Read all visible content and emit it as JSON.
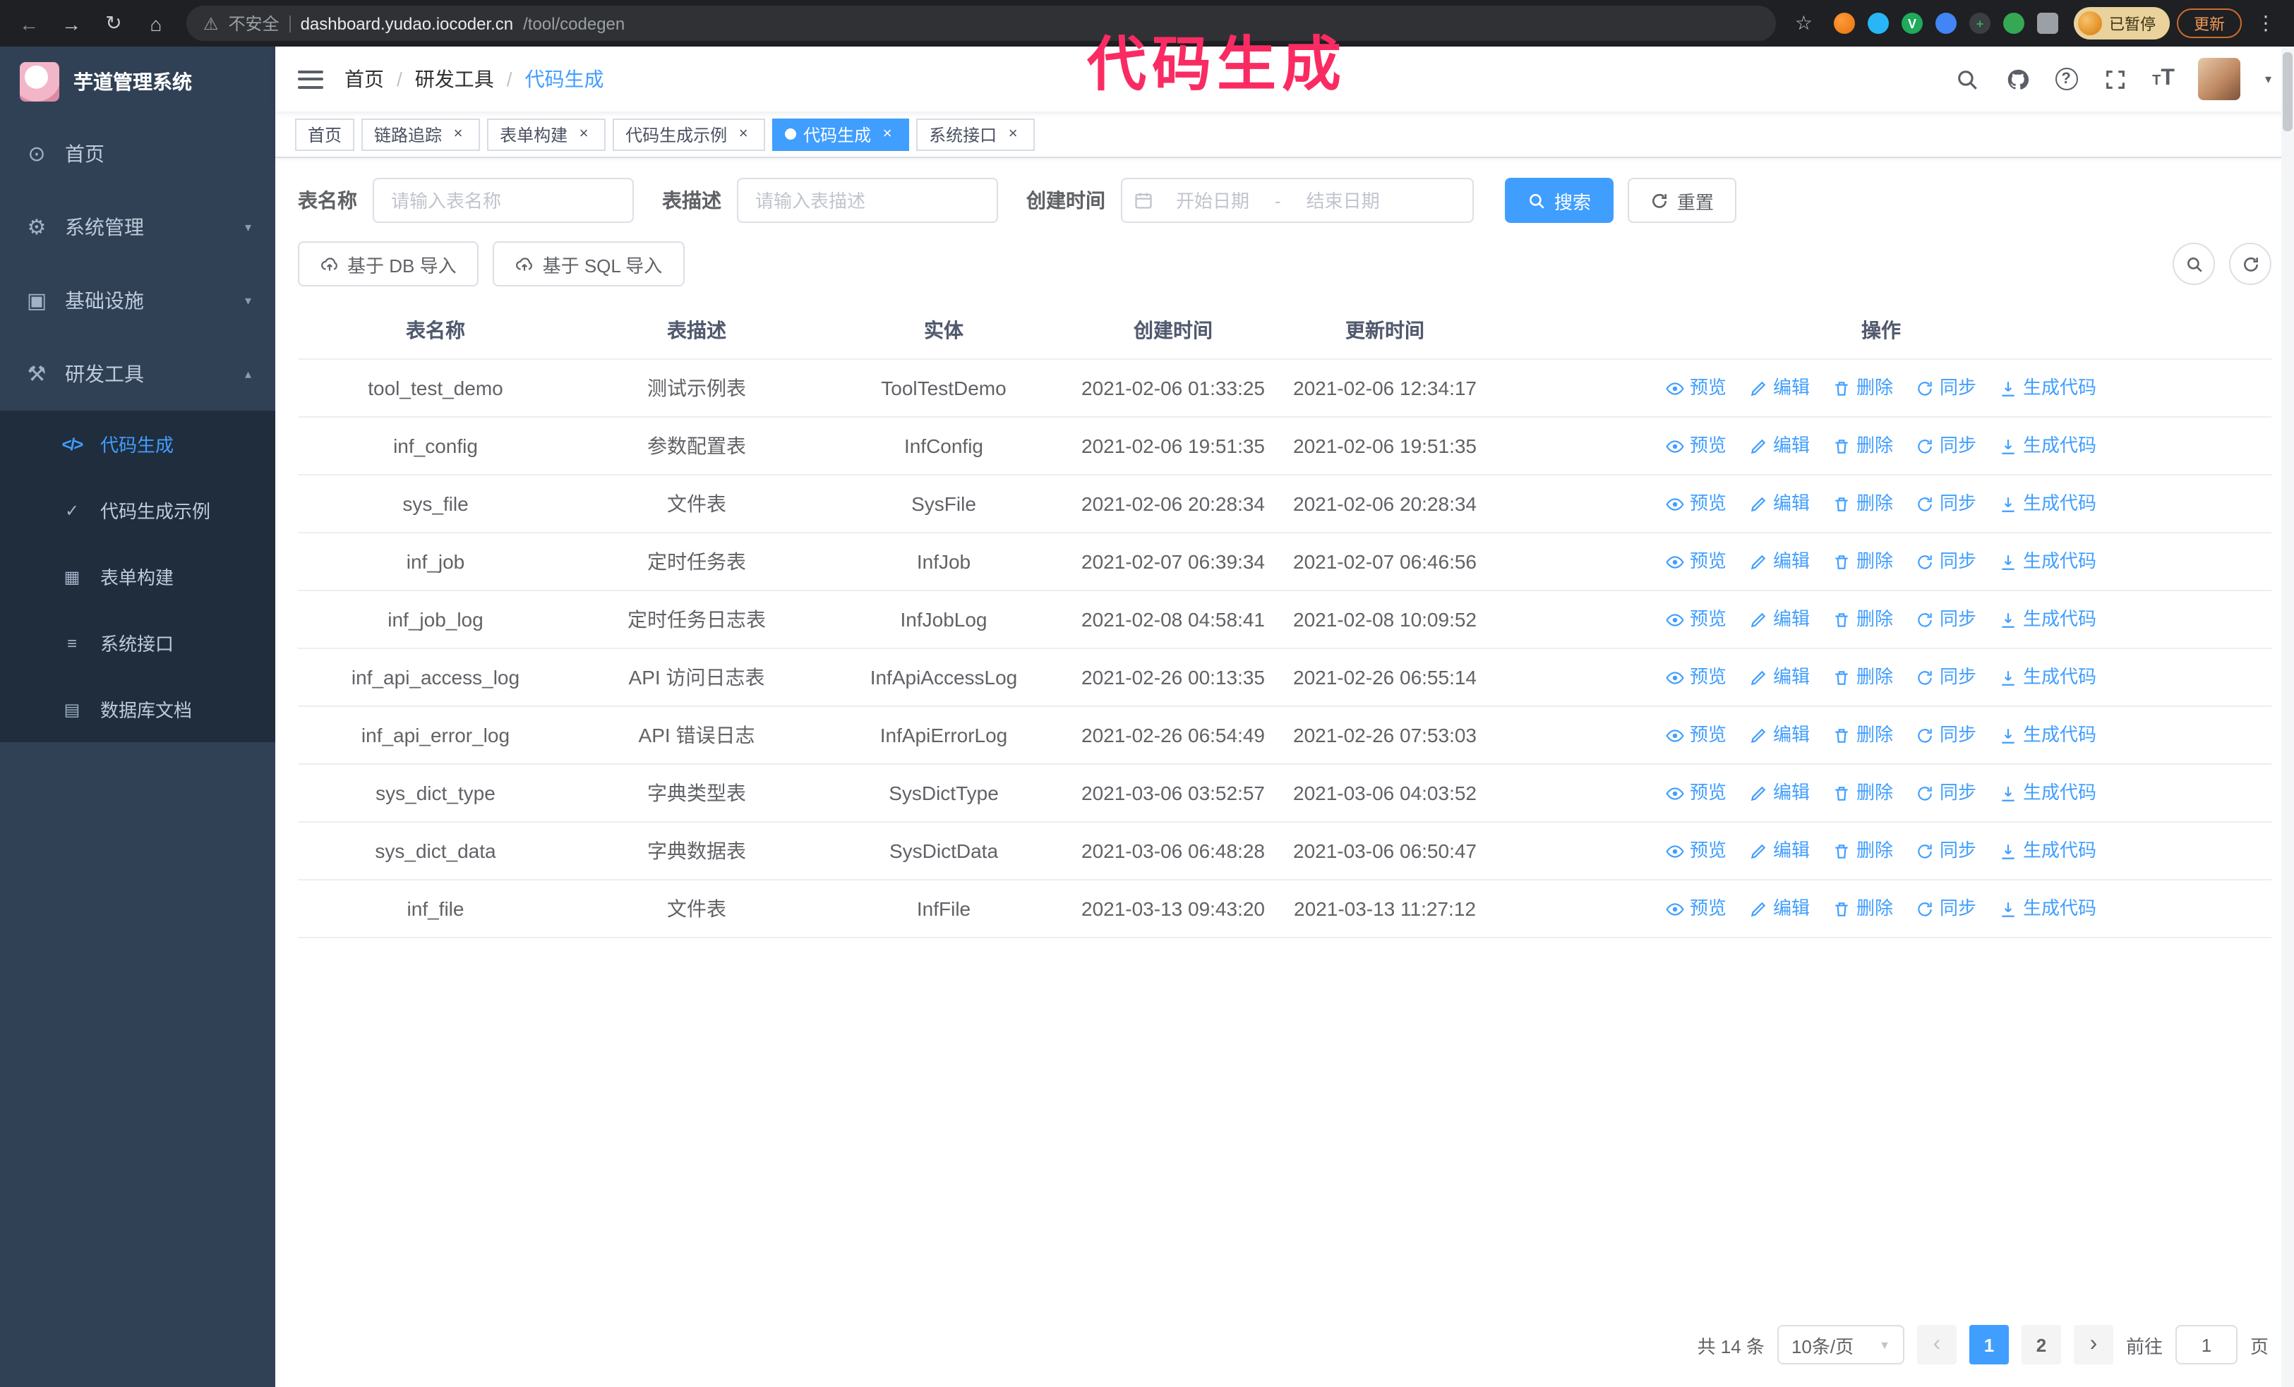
{
  "annotation": {
    "text": "代码生成",
    "color": "#fa2b63"
  },
  "colors": {
    "accent": "#409eff",
    "sidebar_bg": "#304156",
    "submenu_bg": "#1f2d3d",
    "tag_active": "#409eff"
  },
  "browser": {
    "insecure_label": "不安全",
    "host": "dashboard.yudao.iocoder.cn",
    "path": "/tool/codegen",
    "paused_label": "已暂停",
    "update_label": "更新"
  },
  "ui": {
    "back": "←",
    "forward": "→",
    "reload": "↻",
    "home": "⌂",
    "warn": "⚠",
    "star": "☆",
    "kebab": "⋮",
    "slash": "/",
    "close": "×",
    "caret_down": "▾",
    "caret_up": "▴",
    "chevron_left": "‹",
    "chevron_right": "›",
    "select_caret": "▼",
    "question": "?",
    "fsize_small": "T",
    "fsize_big": "T",
    "ext_v": "V",
    "ext_plus": "+"
  },
  "sidebar": {
    "logo_title": "芋道管理系统",
    "items": [
      {
        "label": "首页",
        "icon_glyph": "⊙"
      },
      {
        "label": "系统管理",
        "icon_glyph": "⚙"
      },
      {
        "label": "基础设施",
        "icon_glyph": "▣"
      },
      {
        "label": "研发工具",
        "icon_glyph": "⚒",
        "children": [
          {
            "label": "代码生成",
            "icon_glyph": "</>",
            "active": true
          },
          {
            "label": "代码生成示例",
            "icon_glyph": "✓"
          },
          {
            "label": "表单构建",
            "icon_glyph": "▦"
          },
          {
            "label": "系统接口",
            "icon_glyph": "≡"
          },
          {
            "label": "数据库文档",
            "icon_glyph": "▤"
          }
        ]
      }
    ]
  },
  "breadcrumb": {
    "items": [
      "首页",
      "研发工具",
      "代码生成"
    ]
  },
  "tabs": [
    {
      "label": "首页",
      "closable": false,
      "active": false
    },
    {
      "label": "链路追踪",
      "closable": true,
      "active": false
    },
    {
      "label": "表单构建",
      "closable": true,
      "active": false
    },
    {
      "label": "代码生成示例",
      "closable": true,
      "active": false
    },
    {
      "label": "代码生成",
      "closable": true,
      "active": true
    },
    {
      "label": "系统接口",
      "closable": true,
      "active": false
    }
  ],
  "filters": {
    "name_label": "表名称",
    "name_placeholder": "请输入表名称",
    "desc_label": "表描述",
    "desc_placeholder": "请输入表描述",
    "time_label": "创建时间",
    "start_placeholder": "开始日期",
    "range_separator": "-",
    "end_placeholder": "结束日期",
    "search_label": "搜索",
    "reset_label": "重置"
  },
  "toolbar": {
    "import_db_label": "基于 DB 导入",
    "import_sql_label": "基于 SQL 导入"
  },
  "table": {
    "columns": [
      "表名称",
      "表描述",
      "实体",
      "创建时间",
      "更新时间",
      "操作"
    ],
    "action_labels": [
      "预览",
      "编辑",
      "删除",
      "同步",
      "生成代码"
    ],
    "rows": [
      {
        "name": "tool_test_demo",
        "desc": "测试示例表",
        "entity": "ToolTestDemo",
        "created": "2021-02-06 01:33:25",
        "updated": "2021-02-06 12:34:17"
      },
      {
        "name": "inf_config",
        "desc": "参数配置表",
        "entity": "InfConfig",
        "created": "2021-02-06 19:51:35",
        "updated": "2021-02-06 19:51:35"
      },
      {
        "name": "sys_file",
        "desc": "文件表",
        "entity": "SysFile",
        "created": "2021-02-06 20:28:34",
        "updated": "2021-02-06 20:28:34"
      },
      {
        "name": "inf_job",
        "desc": "定时任务表",
        "entity": "InfJob",
        "created": "2021-02-07 06:39:34",
        "updated": "2021-02-07 06:46:56"
      },
      {
        "name": "inf_job_log",
        "desc": "定时任务日志表",
        "entity": "InfJobLog",
        "created": "2021-02-08 04:58:41",
        "updated": "2021-02-08 10:09:52"
      },
      {
        "name": "inf_api_access_log",
        "desc": "API 访问日志表",
        "entity": "InfApiAccessLog",
        "created": "2021-02-26 00:13:35",
        "updated": "2021-02-26 06:55:14"
      },
      {
        "name": "inf_api_error_log",
        "desc": "API 错误日志",
        "entity": "InfApiErrorLog",
        "created": "2021-02-26 06:54:49",
        "updated": "2021-02-26 07:53:03"
      },
      {
        "name": "sys_dict_type",
        "desc": "字典类型表",
        "entity": "SysDictType",
        "created": "2021-03-06 03:52:57",
        "updated": "2021-03-06 04:03:52"
      },
      {
        "name": "sys_dict_data",
        "desc": "字典数据表",
        "entity": "SysDictData",
        "created": "2021-03-06 06:48:28",
        "updated": "2021-03-06 06:50:47"
      },
      {
        "name": "inf_file",
        "desc": "文件表",
        "entity": "InfFile",
        "created": "2021-03-13 09:43:20",
        "updated": "2021-03-13 11:27:12"
      }
    ]
  },
  "pagination": {
    "total": "共 14 条",
    "page_size": "10条/页",
    "pages": [
      "1",
      "2"
    ],
    "active_page": "1",
    "goto_prefix": "前往",
    "goto_value": "1",
    "goto_suffix": "页"
  }
}
